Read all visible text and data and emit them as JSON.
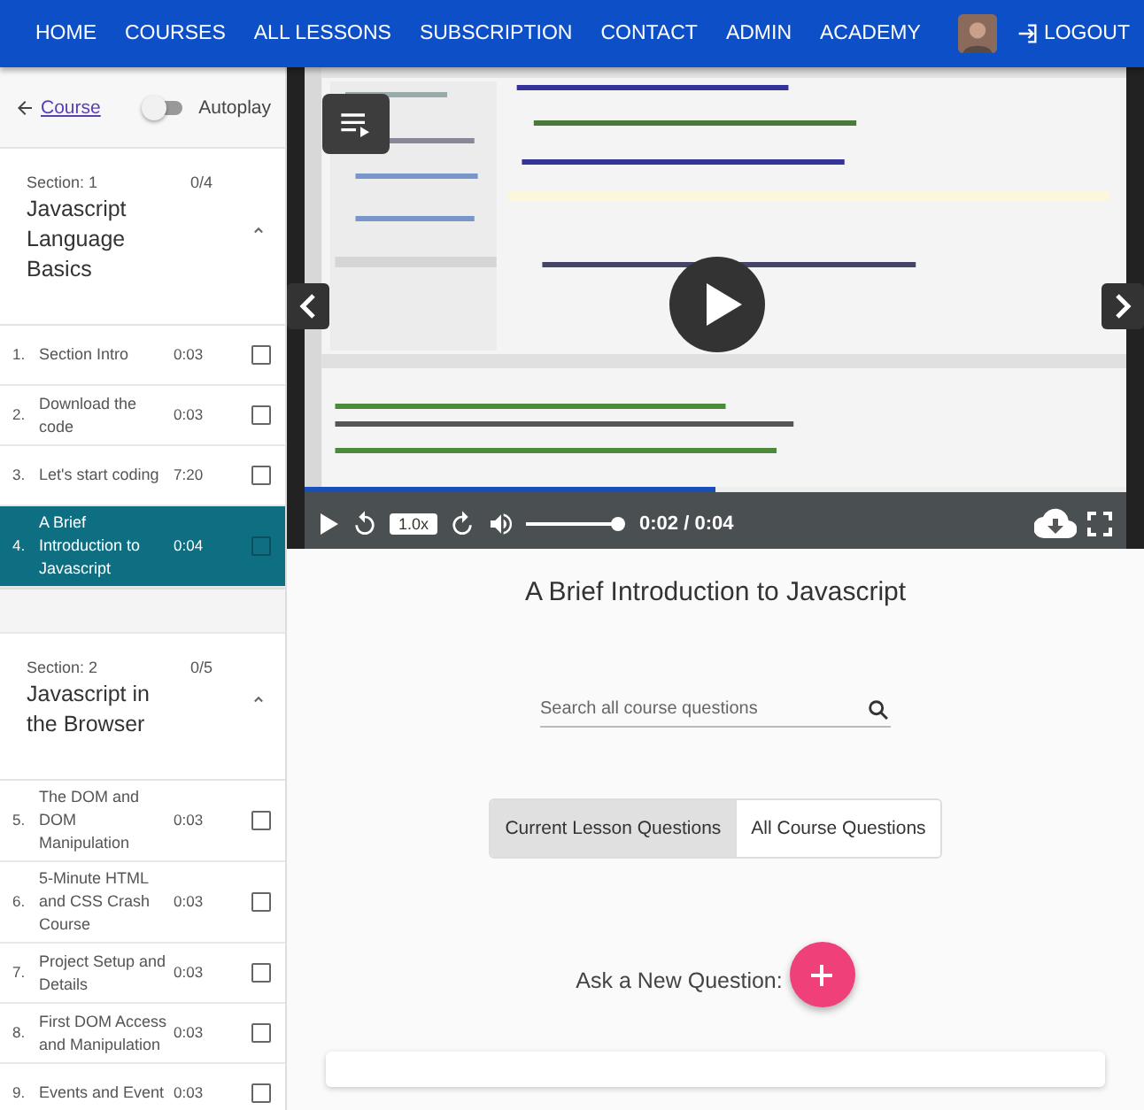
{
  "nav": {
    "links": [
      {
        "label": "HOME"
      },
      {
        "label": "COURSES"
      },
      {
        "label": "ALL LESSONS"
      },
      {
        "label": "SUBSCRIPTION"
      },
      {
        "label": "CONTACT"
      },
      {
        "label": "ADMIN"
      },
      {
        "label": "ACADEMY"
      }
    ],
    "logout": "LOGOUT"
  },
  "sidebar": {
    "back_link": "Course",
    "autoplay": {
      "label": "Autoplay",
      "on": false
    },
    "sections": [
      {
        "label": "Section: 1",
        "progress": "0/4",
        "title": "Javascript Language Basics",
        "expanded": true,
        "lessons": [
          {
            "number": "1.",
            "title": "Section Intro",
            "duration": "0:03",
            "checked": false,
            "selected": false
          },
          {
            "number": "2.",
            "title": "Download the code",
            "duration": "0:03",
            "checked": false,
            "selected": false
          },
          {
            "number": "3.",
            "title": "Let's start coding",
            "duration": "7:20",
            "checked": false,
            "selected": false
          },
          {
            "number": "4.",
            "title": "A Brief Introduction to Javascript",
            "duration": "0:04",
            "checked": false,
            "selected": true
          }
        ]
      },
      {
        "label": "Section: 2",
        "progress": "0/5",
        "title": "Javascript in the Browser",
        "expanded": true,
        "lessons": [
          {
            "number": "5.",
            "title": "The DOM and DOM Manipulation",
            "duration": "0:03",
            "checked": false,
            "selected": false
          },
          {
            "number": "6.",
            "title": "5-Minute HTML and CSS Crash Course",
            "duration": "0:03",
            "checked": false,
            "selected": false
          },
          {
            "number": "7.",
            "title": "Project Setup and Details",
            "duration": "0:03",
            "checked": false,
            "selected": false
          },
          {
            "number": "8.",
            "title": "First DOM Access and Manipulation",
            "duration": "0:03",
            "checked": false,
            "selected": false
          },
          {
            "number": "9.",
            "title": "Events and Event",
            "duration": "0:03",
            "checked": false,
            "selected": false
          }
        ]
      }
    ]
  },
  "video": {
    "buffered": {
      "level": 0.5
    },
    "progress": {
      "level": 0.5
    },
    "speed": "1.0x",
    "volume": {
      "level": 1
    },
    "time": "0:02 / 0:04"
  },
  "lesson_title": "A Brief Introduction to Javascript",
  "search": {
    "placeholder": "Search all course questions"
  },
  "question_tabs": [
    {
      "label": "Current Lesson Questions",
      "selected": true
    },
    {
      "label": "All Course Questions",
      "selected": false
    }
  ],
  "ask_label": "Ask a New Question:"
}
